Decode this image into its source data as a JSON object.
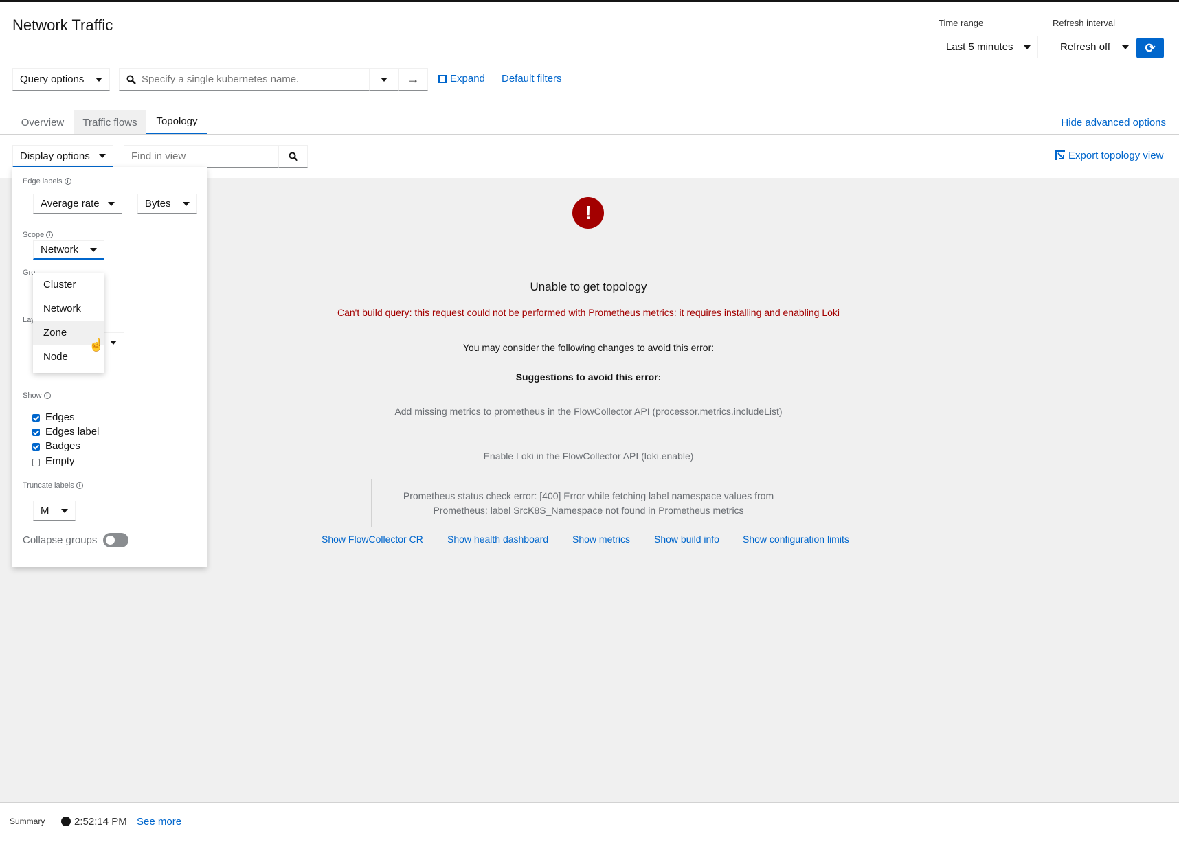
{
  "header": {
    "title": "Network Traffic",
    "time_range_label": "Time range",
    "time_range_value": "Last 5 minutes",
    "refresh_label": "Refresh interval",
    "refresh_value": "Refresh off"
  },
  "query": {
    "options_label": "Query options",
    "search_placeholder": "Specify a single kubernetes name.",
    "expand_label": "Expand",
    "default_filters_label": "Default filters"
  },
  "tabs": [
    {
      "label": "Overview"
    },
    {
      "label": "Traffic flows"
    },
    {
      "label": "Topology"
    }
  ],
  "hide_advanced_label": "Hide advanced options",
  "toolbar": {
    "display_options_label": "Display options",
    "find_placeholder": "Find in view",
    "export_label": "Export topology view"
  },
  "display_panel": {
    "edge_labels_title": "Edge labels",
    "edge_metric": "Average rate",
    "edge_unit": "Bytes",
    "scope_title": "Scope",
    "scope_value": "Network",
    "scope_options": [
      "Cluster",
      "Network",
      "Zone",
      "Node"
    ],
    "group_title_partial": "Gro",
    "layout_title_partial": "Lay",
    "show_title": "Show",
    "show_items": [
      {
        "label": "Edges",
        "checked": true
      },
      {
        "label": "Edges label",
        "checked": true
      },
      {
        "label": "Badges",
        "checked": true
      },
      {
        "label": "Empty",
        "checked": false
      }
    ],
    "truncate_title": "Truncate labels",
    "truncate_value": "M",
    "collapse_label": "Collapse groups",
    "collapse_on": false
  },
  "error": {
    "title": "Unable to get topology",
    "message": "Can't build query: this request could not be performed with Prometheus metrics: it requires installing and enabling Loki",
    "consider": "You may consider the following changes to avoid this error:",
    "suggestions_title": "Suggestions to avoid this error:",
    "suggestions": [
      "Add missing metrics to prometheus in the FlowCollector API (processor.metrics.includeList)",
      "Enable Loki in the FlowCollector API (loki.enable)"
    ],
    "detail_line1": "Prometheus status check error: [400] Error while fetching label namespace values from",
    "detail_line2": "Prometheus: label SrcK8S_Namespace not found in Prometheus metrics",
    "links": [
      "Show FlowCollector CR",
      "Show health dashboard",
      "Show metrics",
      "Show build info",
      "Show configuration limits"
    ]
  },
  "footer": {
    "summary_label": "Summary",
    "time": "2:52:14 PM",
    "see_more": "See more"
  },
  "colors": {
    "accent": "#0066cc",
    "error": "#a30000"
  }
}
